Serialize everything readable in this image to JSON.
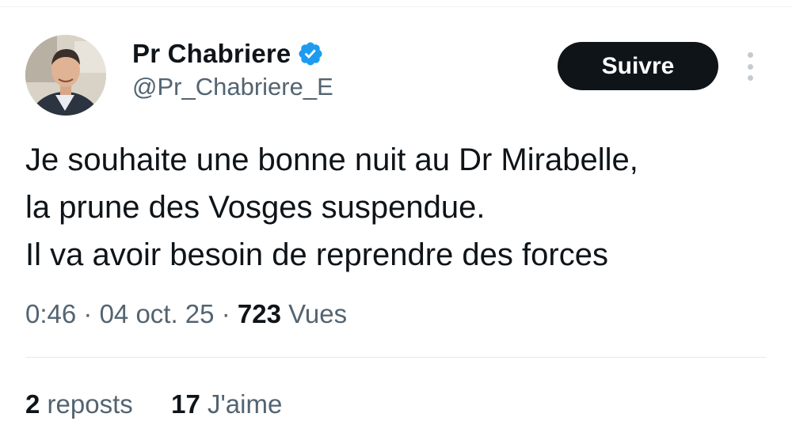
{
  "author": {
    "display_name": "Pr Chabriere",
    "handle": "@Pr_Chabriere_E",
    "verified": true,
    "verified_color": "#1d9bf0"
  },
  "follow_button": {
    "label": "Suivre"
  },
  "more_menu": {
    "icon": "more-vertical-icon"
  },
  "tweet": {
    "lines": [
      "Je souhaite une bonne nuit au Dr Mirabelle,",
      "la prune des Vosges suspendue.",
      "Il va avoir besoin de reprendre des forces"
    ]
  },
  "meta": {
    "time": "0:46",
    "separator": "·",
    "date": "04 oct. 25",
    "views_count": "723",
    "views_label": "Vues"
  },
  "stats": {
    "reposts_count": "2",
    "reposts_label": "reposts",
    "likes_count": "17",
    "likes_label": "J'aime"
  },
  "colors": {
    "text_primary": "#0f1419",
    "text_secondary": "#536471",
    "button_bg": "#0f1419",
    "divider": "#eff3f4"
  }
}
